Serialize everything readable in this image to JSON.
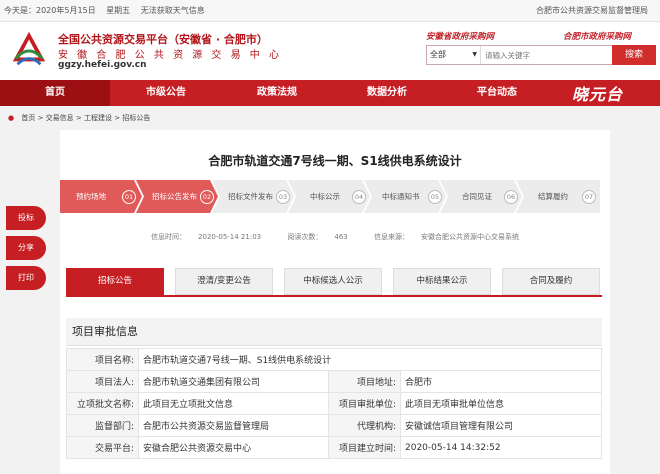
{
  "topbar": {
    "date": "今天是：2020年5月15日",
    "weekday": "星期五",
    "weather": "无法获取天气信息",
    "right_link": "合肥市公共资源交易监督管理局"
  },
  "header": {
    "title": "全国公共资源交易平台（安徽省 · 合肥市）",
    "subtitle": "安 徽 合 肥 公 共 资 源 交 易 中 心",
    "url": "ggzy.hefei.gov.cn",
    "slogan_left": "安徽省政府采购网",
    "slogan_right": "合肥市政府采购网",
    "logo_icon": "hefei-logo-icon",
    "colors": {
      "brand": "#c51e23",
      "brand_dark": "#9c1013"
    }
  },
  "search": {
    "scope": "全部",
    "placeholder": "请输入关键字",
    "button": "搜索"
  },
  "nav": {
    "items": [
      "首页",
      "市级公告",
      "政策法规",
      "数据分析",
      "平台动态"
    ],
    "brand": "晓元台"
  },
  "breadcrumb": {
    "home": "首页",
    "sep": ">",
    "items": [
      "交易信息",
      "工程建设",
      "招标公告"
    ]
  },
  "project": {
    "title": "合肥市轨道交通7号线一期、S1线供电系统设计"
  },
  "steps": [
    {
      "label": "预约场地",
      "num": "01",
      "state": "on"
    },
    {
      "label": "招标公告发布",
      "num": "02",
      "state": "on"
    },
    {
      "label": "招标文件发布",
      "num": "03",
      "state": "off"
    },
    {
      "label": "中标公示",
      "num": "04",
      "state": "off"
    },
    {
      "label": "中标通知书",
      "num": "05",
      "state": "off"
    },
    {
      "label": "合同见证",
      "num": "06",
      "state": "off"
    },
    {
      "label": "结算履约",
      "num": "07",
      "state": "off"
    }
  ],
  "meta": {
    "time_label": "信息时间：",
    "time": "2020-05-14 21:03",
    "views_label": "阅读次数：",
    "views": "463",
    "source_label": "信息来源：",
    "source": "安徽合肥公共资源中心交易系统"
  },
  "side": {
    "bid": "投标",
    "share": "分享",
    "print": "打印"
  },
  "tabs": [
    "招标公告",
    "澄清/变更公告",
    "中标候选人公示",
    "中标结果公示",
    "合同及履约"
  ],
  "info": {
    "section_title": "项目审批信息",
    "rows": [
      {
        "k": "项目名称:",
        "v": "合肥市轨道交通7号线一期、S1线供电系统设计"
      },
      {
        "k": "项目法人:",
        "v": "合肥市轨道交通集团有限公司",
        "k2": "项目地址:",
        "v2": "合肥市"
      },
      {
        "k": "立项批文名称:",
        "v": "此项目无立项批文信息",
        "k2": "项目审批单位:",
        "v2": "此项目无项审批单位信息"
      },
      {
        "k": "监督部门:",
        "v": "合肥市公共资源交易监督管理局",
        "k2": "代理机构:",
        "v2": "安徽诚信项目管理有限公司"
      },
      {
        "k": "交易平台:",
        "v": "安徽合肥公共资源交易中心",
        "k2": "项目建立时间:",
        "v2": "2020-05-14 14:32:52"
      }
    ]
  }
}
